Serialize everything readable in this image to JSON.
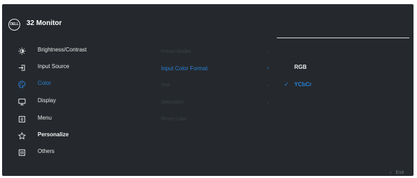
{
  "header": {
    "logo_text": "DELL",
    "title": "32 Monitor"
  },
  "main_menu": [
    {
      "label": "Brightness/Contrast",
      "icon": "brightness-icon"
    },
    {
      "label": "Input Source",
      "icon": "input-source-icon"
    },
    {
      "label": "Color",
      "icon": "color-icon",
      "selected": true
    },
    {
      "label": "Display",
      "icon": "display-icon"
    },
    {
      "label": "Menu",
      "icon": "menu-icon"
    },
    {
      "label": "Personalize",
      "icon": "star-icon"
    },
    {
      "label": "Others",
      "icon": "others-icon"
    }
  ],
  "color_submenu": [
    {
      "label": "Preset Modes",
      "chevron": "›"
    },
    {
      "label": "Input Color Format",
      "chevron": "›",
      "selected": true
    },
    {
      "label": "Hue",
      "chevron": "›"
    },
    {
      "label": "Saturation",
      "chevron": "›"
    },
    {
      "label": "Reset Color",
      "chevron": ""
    }
  ],
  "options": [
    {
      "label": "RGB",
      "checked": false
    },
    {
      "label": "YCbCr",
      "checked": true,
      "check_mark": "✓"
    }
  ],
  "footer": {
    "exit_chevron": "‹",
    "exit_label": "Exit"
  },
  "colors": {
    "panel": "#25292d",
    "accent": "#2a7fd4",
    "text": "#e6e6e6",
    "dim": "#3b4146"
  }
}
